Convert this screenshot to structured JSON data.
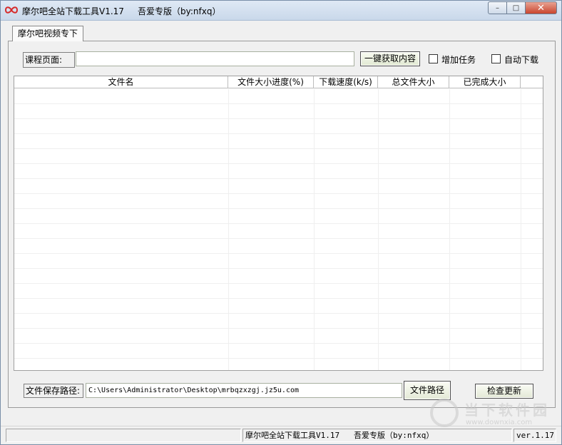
{
  "window": {
    "title": "摩尔吧全站下载工具V1.17     吾爱专版（by:nfxq）",
    "controls": {
      "minimize": "–",
      "maximize": "□",
      "close": "✕"
    }
  },
  "tabs": [
    {
      "label": "摩尔吧视频专下"
    }
  ],
  "course": {
    "label": "课程页面:",
    "value": "",
    "fetch_button": "一键获取内容",
    "add_task_label": "增加任务",
    "auto_download_label": "自动下载"
  },
  "grid": {
    "columns": [
      {
        "label": "文件名"
      },
      {
        "label": "文件大小"
      },
      {
        "label": "进度(%)"
      },
      {
        "label": "下载速度(k/s)"
      },
      {
        "label": "总文件大小"
      },
      {
        "label": "已完成大小"
      }
    ],
    "rows": []
  },
  "save": {
    "label": "文件保存路径:",
    "path": "C:\\Users\\Administrator\\Desktop\\mrbqzxzgj.jz5u.com",
    "path_button": "文件路径",
    "update_button": "检查更新"
  },
  "statusbar": {
    "left": "",
    "middle": "摩尔吧全站下载工具V1.17   吾爱专版（by:nfxq）",
    "right": "ver.1.17"
  },
  "watermark": {
    "text": "当下软件园",
    "url": "www.downxia.com"
  },
  "colors": {
    "accent_close": "#c9452e",
    "titlebar": "#c9d8ea"
  }
}
